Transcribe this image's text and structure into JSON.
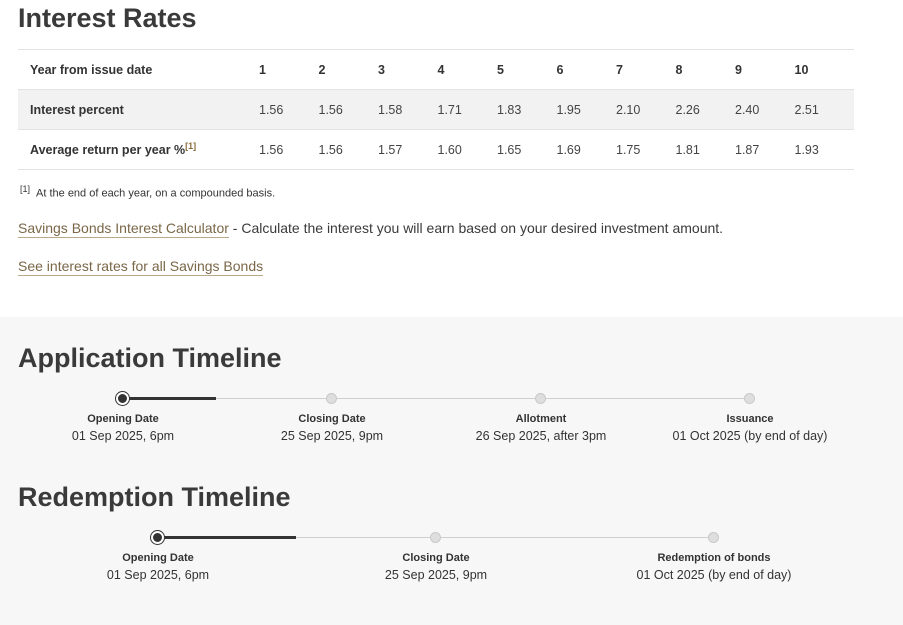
{
  "interest": {
    "title": "Interest Rates",
    "table": {
      "header_label": "Year from issue date",
      "years": [
        "1",
        "2",
        "3",
        "4",
        "5",
        "6",
        "7",
        "8",
        "9",
        "10"
      ],
      "rows": [
        {
          "label": "Interest percent",
          "values": [
            "1.56",
            "1.56",
            "1.58",
            "1.71",
            "1.83",
            "1.95",
            "2.10",
            "2.26",
            "2.40",
            "2.51"
          ]
        },
        {
          "label": "Average return per year %",
          "footnote_ref": "[1]",
          "values": [
            "1.56",
            "1.56",
            "1.57",
            "1.60",
            "1.65",
            "1.69",
            "1.75",
            "1.81",
            "1.87",
            "1.93"
          ]
        }
      ]
    },
    "footnote": {
      "marker": "[1]",
      "text": "At the end of each year, on a compounded basis."
    },
    "calculator_link": "Savings Bonds Interest Calculator",
    "calculator_desc": " - Calculate the interest you will earn based on your desired investment amount.",
    "all_rates_link": "See interest rates for all Savings Bonds"
  },
  "application_timeline": {
    "title": "Application Timeline",
    "progress_fraction": 0.15,
    "steps": [
      {
        "title": "Opening Date",
        "date": "01 Sep 2025, 6pm"
      },
      {
        "title": "Closing Date",
        "date": "25 Sep 2025, 9pm"
      },
      {
        "title": "Allotment",
        "date": "26 Sep 2025, after 3pm"
      },
      {
        "title": "Issuance",
        "date": "01 Oct 2025 (by end of day)"
      }
    ]
  },
  "redemption_timeline": {
    "title": "Redemption Timeline",
    "progress_fraction": 0.25,
    "steps": [
      {
        "title": "Opening Date",
        "date": "01 Sep 2025, 6pm"
      },
      {
        "title": "Closing Date",
        "date": "25 Sep 2025, 9pm"
      },
      {
        "title": "Redemption of bonds",
        "date": "01 Oct 2025 (by end of day)"
      }
    ]
  }
}
